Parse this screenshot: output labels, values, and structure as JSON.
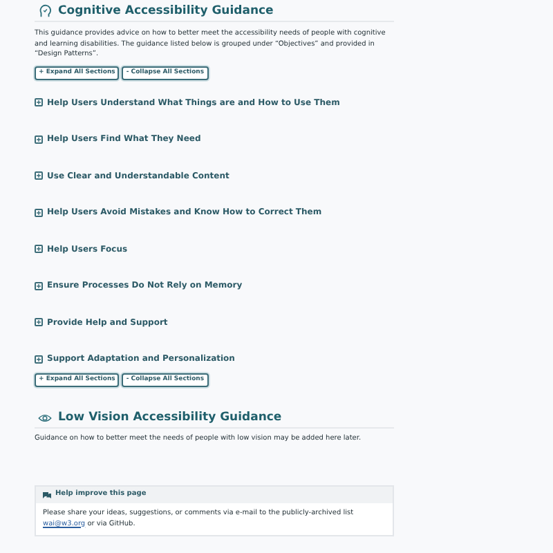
{
  "cognitive": {
    "title": "Cognitive Accessibility Guidance",
    "intro": "This guidance provides advice on how to better meet the accessibility needs of people with cognitive and learning disabilities. The guidance listed below is grouped under “Objectives” and provided in “Design Patterns”.",
    "controls": [
      "+ Expand All Sections",
      "- Collapse All Sections"
    ],
    "sections": [
      {
        "title": "Help Users Understand What Things are and How to Use Them",
        "expanded": false
      },
      {
        "title": "Help Users Find What They Need",
        "expanded": false
      },
      {
        "title": "Use Clear and Understandable Content",
        "expanded": false
      },
      {
        "title": "Help Users Avoid Mistakes and Know How to Correct Them",
        "expanded": false
      },
      {
        "title": "Help Users Focus",
        "expanded": false
      },
      {
        "title": "Ensure Processes Do Not Rely on Memory",
        "expanded": false
      },
      {
        "title": "Provide Help and Support",
        "expanded": false
      },
      {
        "title": "Support Adaptation and Personalization",
        "expanded": false
      }
    ],
    "controls_bottom": [
      "+ Expand All Sections",
      "- Collapse All Sections"
    ]
  },
  "low_vision": {
    "title": "Low Vision Accessibility Guidance",
    "text": "Guidance on how to better meet the needs of people with low vision may be added here later."
  },
  "feedback": {
    "title": "Help improve this page",
    "text_before": "Please share your ideas, suggestions, or comments via e-mail to the publicly-archived list",
    "link": "wai@w3.org",
    "text_after": "or via GitHub."
  }
}
